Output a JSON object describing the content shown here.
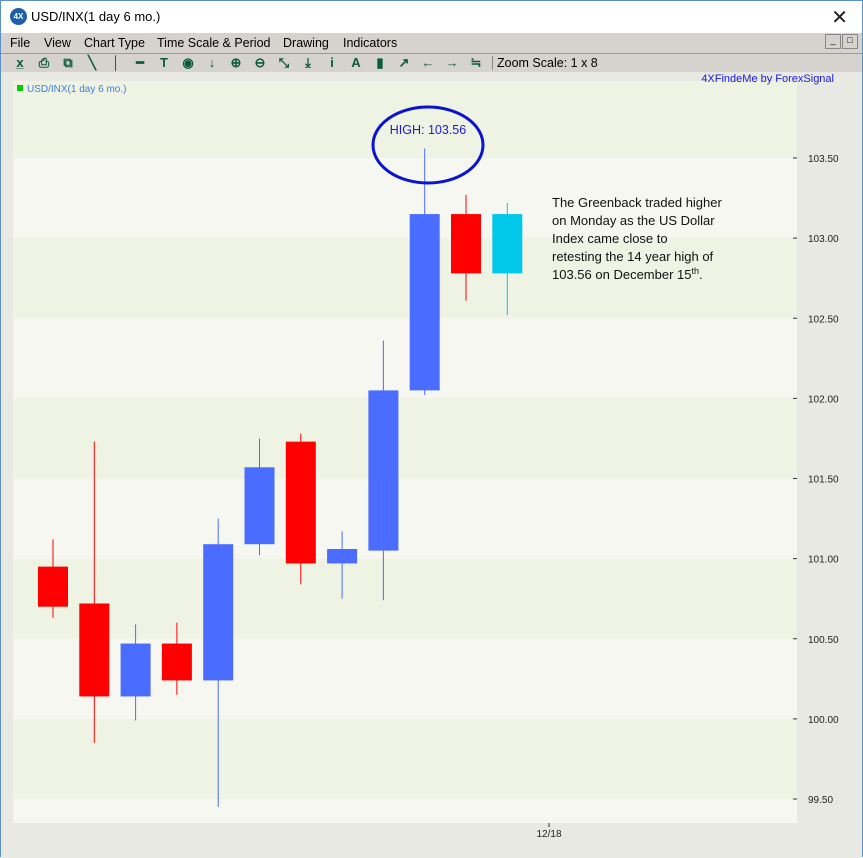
{
  "window": {
    "title": "USD/INX(1 day  6 mo.)",
    "close_label": "✕"
  },
  "menu": [
    "File",
    "View",
    "Chart Type",
    "Time Scale & Period",
    "Drawing",
    "Indicators"
  ],
  "toolbar": {
    "tools": [
      "bar-chart-icon",
      "print-icon",
      "copy-icon",
      "diagonal-line-icon",
      "vertical-line-icon",
      "horizontal-line-icon",
      "text-icon",
      "circle-icon",
      "arrow-down-icon",
      "zoom-in-icon",
      "zoom-out-icon",
      "fit-icon",
      "baseline-icon",
      "info-icon",
      "font-icon",
      "candlestick-icon",
      "line-chart-icon",
      "arrow-left-icon",
      "arrow-right-icon",
      "strikethrough-icon"
    ],
    "zoom_scale": "Zoom Scale: 1 x 8"
  },
  "colors": {
    "up": "#4a6cff",
    "down": "#ff0000",
    "current": "#00c8ea",
    "annotation": "#1010d8",
    "legend_marker": "#00cc00"
  },
  "chart_data": {
    "type": "candlestick",
    "legend": "USD/INX(1 day  6 mo.)",
    "brand": "4XFindeMe by ForexSignal",
    "ylim": [
      99.4,
      103.98
    ],
    "yticks": [
      "99.50",
      "100.00",
      "100.50",
      "101.00",
      "101.50",
      "102.00",
      "102.50",
      "103.00",
      "103.50"
    ],
    "xtick_label": "12/18",
    "candles": [
      {
        "o": 100.95,
        "h": 101.12,
        "l": 100.63,
        "c": 100.7
      },
      {
        "o": 100.72,
        "h": 101.73,
        "l": 99.85,
        "c": 100.14
      },
      {
        "o": 100.14,
        "h": 100.59,
        "l": 99.99,
        "c": 100.47
      },
      {
        "o": 100.47,
        "h": 100.6,
        "l": 100.15,
        "c": 100.24
      },
      {
        "o": 100.24,
        "h": 101.25,
        "l": 99.45,
        "c": 101.09
      },
      {
        "o": 101.09,
        "h": 101.75,
        "l": 101.02,
        "c": 101.57
      },
      {
        "o": 101.73,
        "h": 101.78,
        "l": 100.84,
        "c": 100.97
      },
      {
        "o": 100.97,
        "h": 101.17,
        "l": 100.75,
        "c": 101.06
      },
      {
        "o": 101.05,
        "h": 102.36,
        "l": 100.74,
        "c": 102.05
      },
      {
        "o": 102.05,
        "h": 103.56,
        "l": 102.02,
        "c": 103.15
      },
      {
        "o": 103.15,
        "h": 103.27,
        "l": 102.61,
        "c": 102.78
      },
      {
        "o": 102.78,
        "h": 103.22,
        "l": 102.52,
        "c": 103.15,
        "current": true
      }
    ],
    "high_label": "HIGH: 103.56",
    "annotation": [
      "The Greenback traded higher",
      "on Monday as the US Dollar",
      "Index came close to",
      "retesting the 14 year high of",
      "103.56 on December 15"
    ],
    "annotation_sup": "th",
    "annotation_end": "."
  }
}
